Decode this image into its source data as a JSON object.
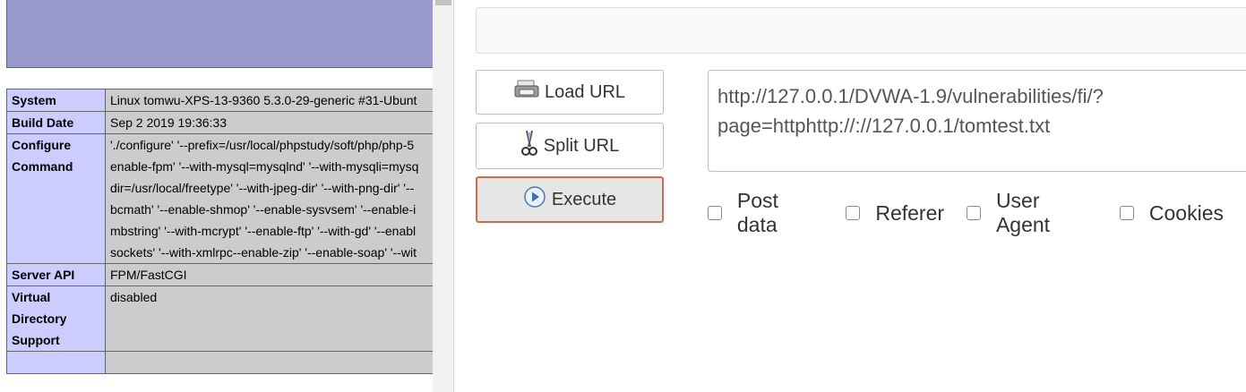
{
  "phpinfo": {
    "rows": [
      {
        "label": "System",
        "value": "Linux tomwu-XPS-13-9360 5.3.0-29-generic #31-Ubunt"
      },
      {
        "label": "Build Date",
        "value": "Sep 2 2019 19:36:33"
      },
      {
        "label_lines": [
          "Configure",
          "Command"
        ],
        "value_lines": [
          "'./configure' '--prefix=/usr/local/phpstudy/soft/php/php-5",
          "enable-fpm' '--with-mysql=mysqlnd' '--with-mysqli=mysq",
          "dir=/usr/local/freetype' '--with-jpeg-dir' '--with-png-dir' '--",
          "bcmath' '--enable-shmop' '--enable-sysvsem' '--enable-i",
          "mbstring' '--with-mcrypt' '--enable-ftp' '--with-gd' '--enabl",
          "sockets' '--with-xmlrpc--enable-zip' '--enable-soap' '--wit"
        ]
      },
      {
        "label": "Server API",
        "value": "FPM/FastCGI"
      },
      {
        "label_lines": [
          "Virtual",
          "Directory",
          "Support"
        ],
        "value": "disabled"
      }
    ]
  },
  "hackbar": {
    "load_url": "Load URL",
    "split_url": "Split URL",
    "execute": "Execute",
    "url_lines": [
      "http://127.0.0.1/DVWA-1.9/vulnerabilities/fi/?",
      "page=httphttp://://127.0.0.1/tomtest.txt"
    ],
    "options": [
      "Post data",
      "Referer",
      "User Agent",
      "Cookies"
    ]
  },
  "colors": {
    "php_header": "#9999cc",
    "php_label_bg": "#ccccff",
    "php_value_bg": "#cccccc",
    "execute_border": "#d46a4c"
  }
}
